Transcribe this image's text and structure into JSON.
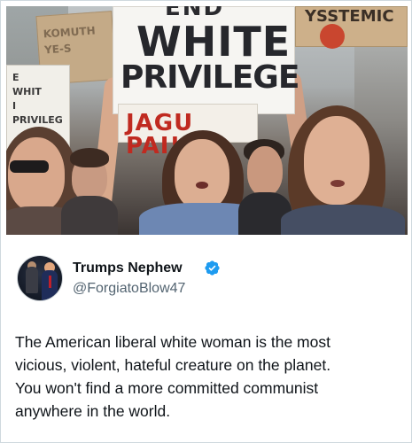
{
  "photo": {
    "alt_icon": "protest-photo",
    "signs": {
      "cardboard_left": [
        "KOMUTH",
        "YE-S"
      ],
      "white_left": [
        "E",
        "WHIT",
        "I",
        "PRIVILEG"
      ],
      "main_top": "END",
      "main_line1": "WHITE",
      "main_line2": "PRIVILEGE",
      "red_sign": "JAGU PAI!",
      "right_sign": "YSSTEMIC"
    }
  },
  "tweet": {
    "display_name": "Trumps Nephew",
    "verified_icon": "verified-badge-icon",
    "verified_color": "#1d9bf0",
    "handle": "@ForgiatoBlow47",
    "text_lines": [
      "The American liberal white woman is the most",
      "vicious, violent, hateful creature on the planet.",
      "You won't find a more committed communist",
      "anywhere in the world."
    ]
  }
}
